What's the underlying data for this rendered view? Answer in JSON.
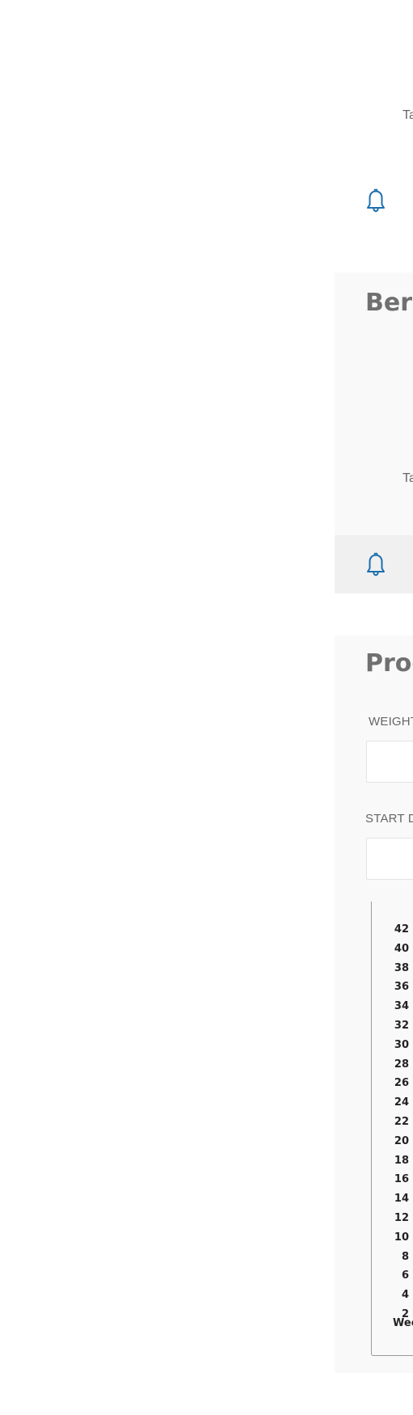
{
  "top_section": {
    "tab_text": "Ta",
    "bell_icon": "bell-icon"
  },
  "bernie_card": {
    "title": "Berr",
    "tab_text": "Ta",
    "bell_icon": "bell-icon"
  },
  "progress_card": {
    "title": "Prog",
    "weight_label": "WEIGHT",
    "start_date_label": "START D",
    "weight_value": "",
    "start_date_value": ""
  },
  "chart_data": {
    "type": "line",
    "y_ticks": [
      "42",
      "40",
      "38",
      "36",
      "34",
      "32",
      "30",
      "28",
      "26",
      "24",
      "22",
      "20",
      "18",
      "16",
      "14",
      "12",
      "10",
      "8",
      "6",
      "4",
      "2"
    ],
    "xlabel": "Wee",
    "series": []
  },
  "colors": {
    "accent": "#1c6fae",
    "panel_bg": "#f9f9f9",
    "footer_bg": "#f0f0f0",
    "title_text": "#707070"
  }
}
